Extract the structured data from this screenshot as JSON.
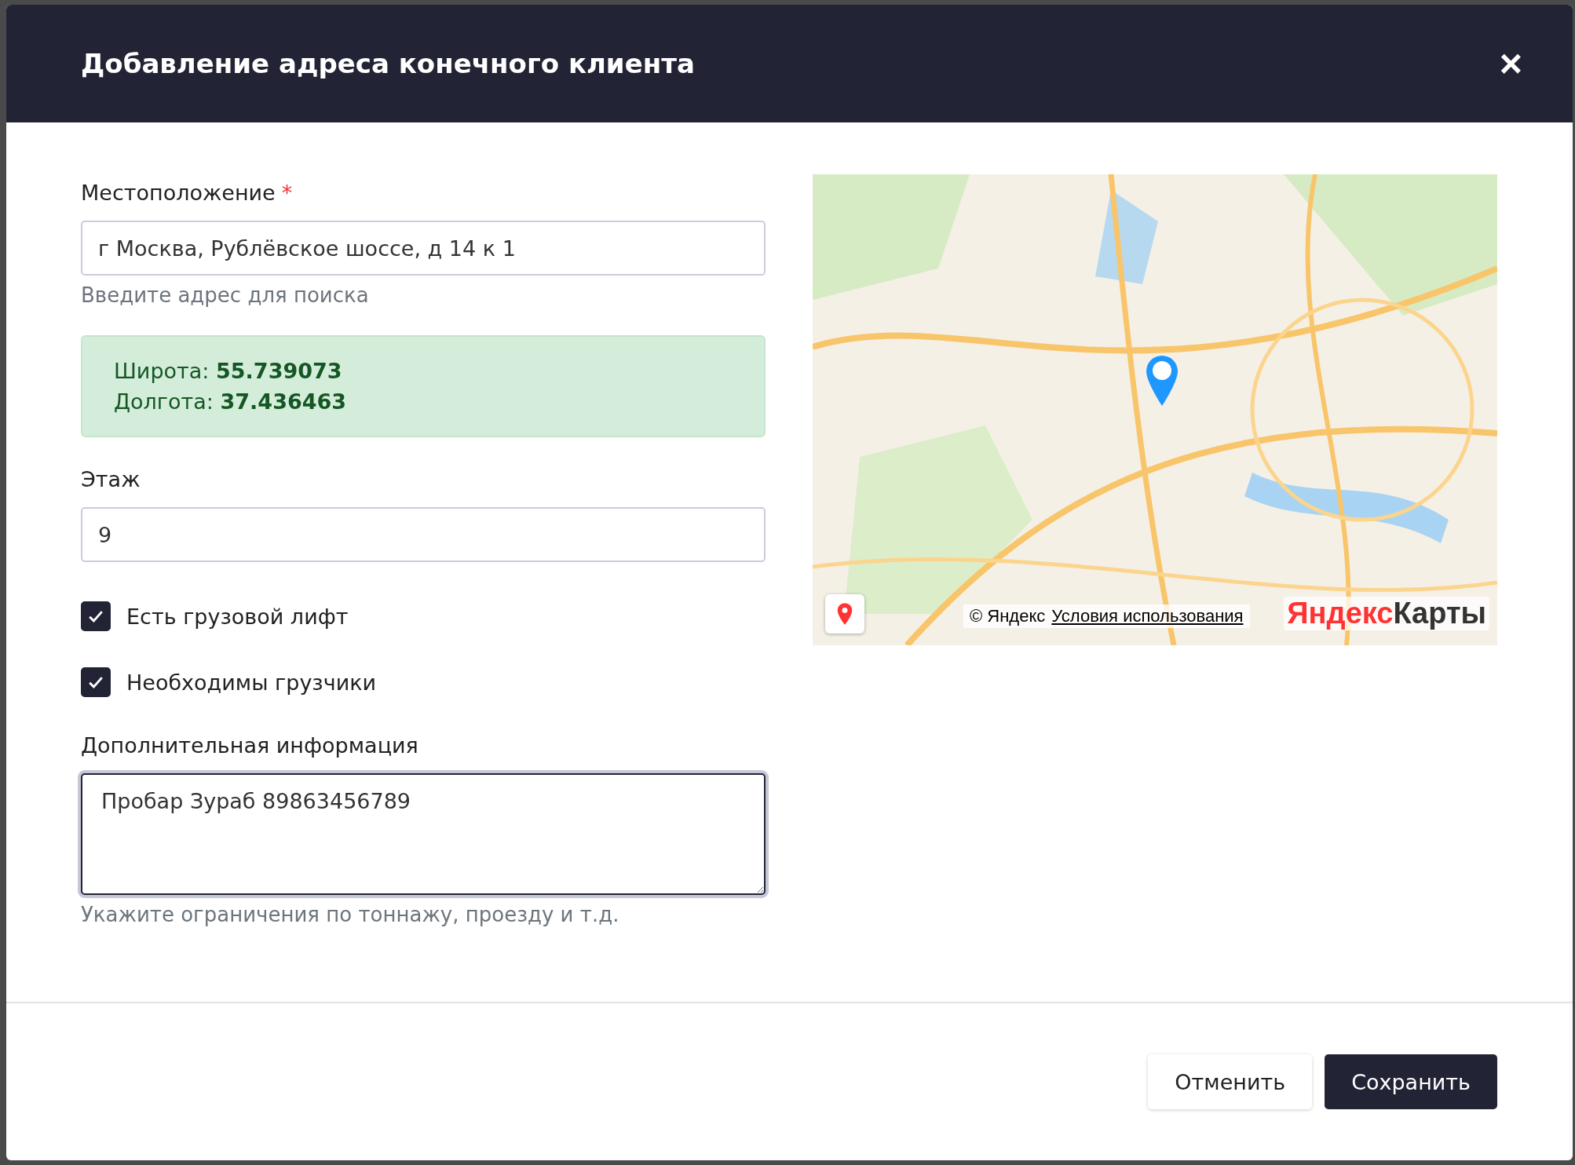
{
  "dialog": {
    "title": "Добавление адреса конечного клиента",
    "close": "×"
  },
  "location": {
    "label": "Местоположение",
    "required_mark": "*",
    "value": "г Москва, Рублёвское шоссе, д 14 к 1",
    "hint": "Введите адрес для поиска"
  },
  "coordinates": [
    {
      "label": "Широта:",
      "value": "55.739073"
    },
    {
      "label": "Долгота:",
      "value": "37.436463"
    }
  ],
  "floor": {
    "label": "Этаж",
    "value": "9"
  },
  "options": [
    {
      "label": "Есть грузовой лифт",
      "checked": true
    },
    {
      "label": "Необходимы грузчики",
      "checked": true
    }
  ],
  "notes": {
    "label": "Дополнительная информация",
    "value": "Пробар Зураб 89863456789",
    "hint": "Укажите ограничения по тоннажу, проезду и т.д.",
    "focused": true
  },
  "map": {
    "copyright": "© Яндекс",
    "terms_link": "Условия использования",
    "logo_first": "Яндекс",
    "logo_second": "Карты"
  },
  "buttons": [
    {
      "label": "Отменить",
      "kind": "secondary"
    },
    {
      "label": "Сохранить",
      "kind": "primary"
    }
  ]
}
